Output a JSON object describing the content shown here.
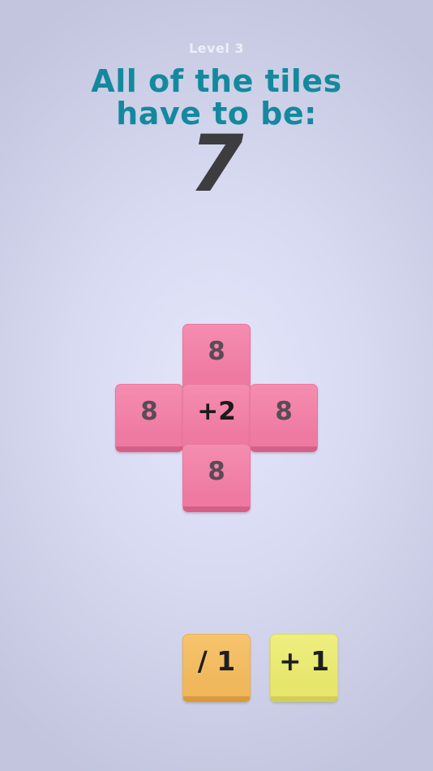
{
  "header": {
    "level": "Level 3",
    "instruction_line1": "All of the tiles",
    "instruction_line2": "have to be:",
    "target": "7"
  },
  "board": {
    "top": "8",
    "left": "8",
    "center": "+2",
    "right": "8",
    "bottom": "8"
  },
  "tray": {
    "slot1": "/ 1",
    "slot2": "+ 1"
  },
  "colors": {
    "tile_pink": "#f087aa",
    "tile_orange": "#f3bd62",
    "tile_yellow": "#eaea74",
    "heading": "#14899e",
    "target": "#3d3d3f"
  }
}
